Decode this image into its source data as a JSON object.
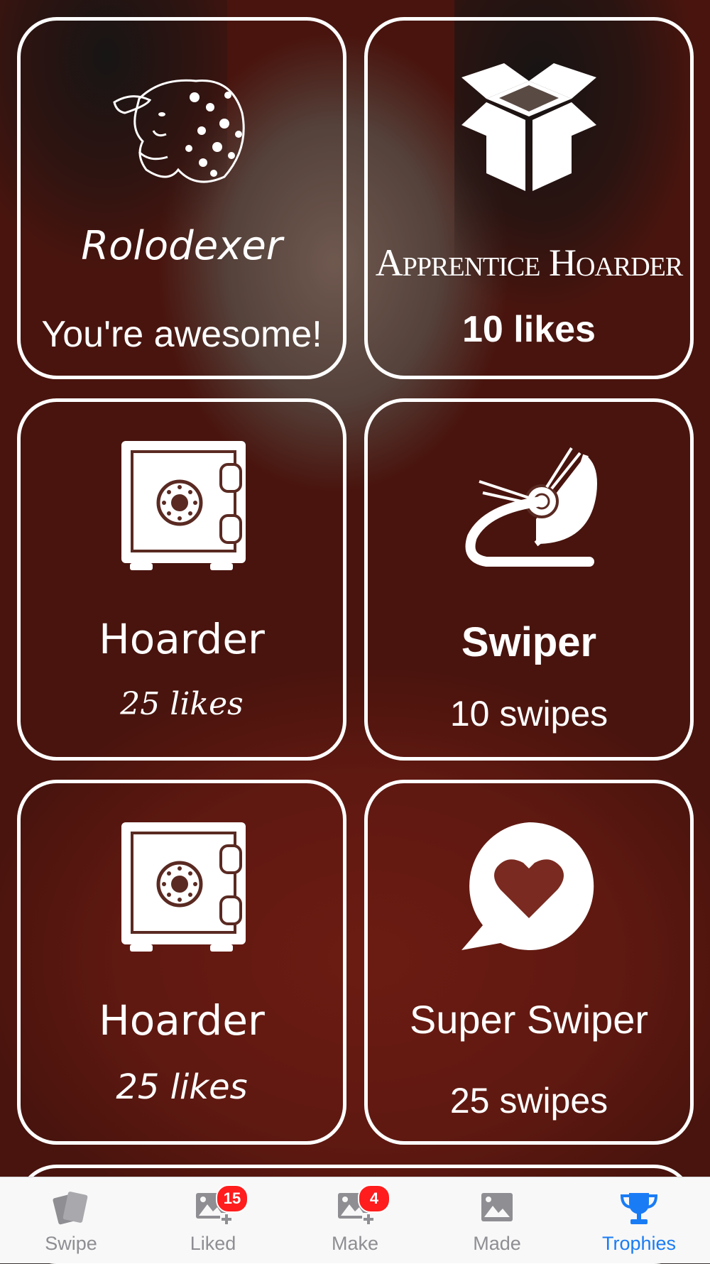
{
  "cards": [
    {
      "title": "Rolodexer",
      "subtitle": "You're awesome!",
      "icon": "sheep-icon"
    },
    {
      "title": "Apprentice Hoarder",
      "subtitle": "10 likes",
      "icon": "open-box-icon"
    },
    {
      "title": "Hoarder",
      "subtitle": "25 likes",
      "icon": "safe-icon"
    },
    {
      "title": "Swiper",
      "subtitle": "10 swipes",
      "icon": "satellite-dish-icon"
    },
    {
      "title": "Hoarder",
      "subtitle": "25 likes",
      "icon": "safe-icon"
    },
    {
      "title": "Super Swiper",
      "subtitle": "25 swipes",
      "icon": "heart-speech-bubble-icon"
    }
  ],
  "tabbar": {
    "tabs": [
      {
        "label": "Swipe",
        "icon": "cards-icon",
        "badge": null,
        "active": false
      },
      {
        "label": "Liked",
        "icon": "image-add-icon",
        "badge": "15",
        "active": false
      },
      {
        "label": "Make",
        "icon": "image-add-icon",
        "badge": "4",
        "active": false
      },
      {
        "label": "Made",
        "icon": "image-icon",
        "badge": null,
        "active": false
      },
      {
        "label": "Trophies",
        "icon": "trophy-icon",
        "badge": null,
        "active": true
      }
    ]
  },
  "colors": {
    "active_tab": "#1a7cf5",
    "inactive_tab": "#8e8e93",
    "badge": "#ff1d1d",
    "card_border": "#ffffff"
  }
}
